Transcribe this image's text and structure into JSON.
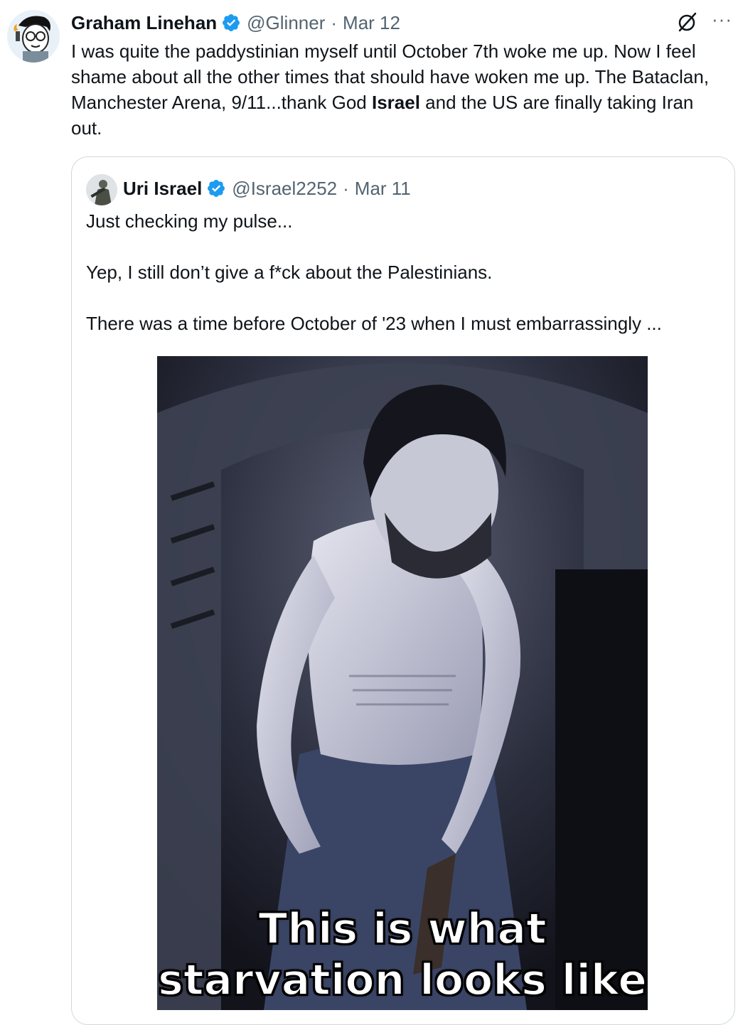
{
  "tweet": {
    "author_name": "Graham Linehan",
    "handle": "@Glinner",
    "separator": "·",
    "date": "Mar 12",
    "more": "···",
    "text_before_bold": "I was quite the paddystinian myself until October 7th woke me up.  Now I feel shame about all the other times that should have woken me up. The Bataclan, Manchester Arena, 9/11...thank God ",
    "text_bold": "Israel",
    "text_after_bold": " and the US are finally taking Iran out."
  },
  "quote": {
    "author_name": "Uri Israel",
    "handle": "@Israel2252",
    "separator": "·",
    "date": "Mar 11",
    "paragraphs": [
      "Just checking my pulse...",
      "Yep, I still don’t give a f*ck about the Palestinians.",
      "There was a time before October of '23 when I must embarrassingly ..."
    ],
    "media_caption_line1": "This is what",
    "media_caption_line2": "starvation looks like"
  },
  "colors": {
    "verified_blue": "#1d9bf0",
    "secondary_text": "#536471",
    "border": "#cfd9de"
  },
  "icons": {
    "verified": "verified-badge-icon",
    "grok": "grok-icon",
    "more": "more-options-icon"
  }
}
